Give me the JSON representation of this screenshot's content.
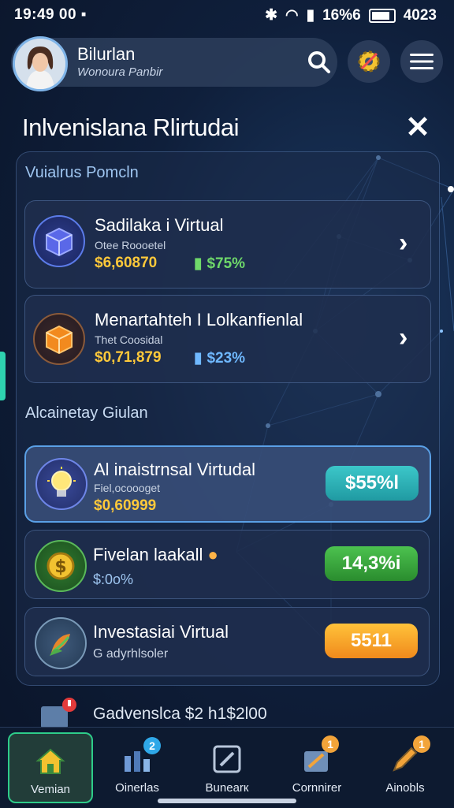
{
  "status_bar": {
    "time": "19:49",
    "left_extra": "00",
    "battery": "16%6",
    "right_text": "4023"
  },
  "header": {
    "user_name": "Bilurlan",
    "user_subtitle": "Wonoura Panbir"
  },
  "page": {
    "title": "Inlvenislana Rlirtudai",
    "close_icon": "✕"
  },
  "section1": {
    "label": "Vuialrus Pomcln",
    "items": [
      {
        "name": "Sadilaka i Virtual",
        "sub": "Otee Roooetel",
        "value": "$6,60870",
        "change": "$75%",
        "icon": "cube-icon"
      },
      {
        "name": "Menartahteh I Lolkanfienlal",
        "sub": "Thet Coosidal",
        "value": "$0,71,879",
        "change": "$23%",
        "icon": "box-icon"
      }
    ]
  },
  "section2": {
    "label": "Alcainetay Giulan",
    "items": [
      {
        "name": "Al inaistrnsal Virtudal",
        "sub": "Fiel,ocoooget",
        "value": "$0,60999",
        "pill": "$55%l",
        "icon": "lightbulb-icon",
        "pill_color": "#2bb3b8"
      },
      {
        "name": "Fivelan laakall",
        "sub": "$:0o%",
        "pill": "14,3%i",
        "icon": "coin-icon",
        "pill_color": "#3aa83e"
      },
      {
        "name": "Investasiai Virtual",
        "sub": "G adyrhlsoler",
        "pill": "5511",
        "icon": "plant-icon",
        "pill_color": "#f0a128"
      }
    ]
  },
  "footer_item": {
    "text": "Gadvenslca $2 h1$2l00"
  },
  "nav": {
    "items": [
      {
        "label": "Vemian",
        "icon": "home-icon"
      },
      {
        "label": "Oinerlas",
        "icon": "chart-icon",
        "badge": "2"
      },
      {
        "label": "Bunearк",
        "icon": "edit-icon"
      },
      {
        "label": "Cornnirer",
        "icon": "community-icon",
        "badge": "1"
      },
      {
        "label": "Ainobls",
        "icon": "pencil-icon",
        "badge": "1"
      }
    ]
  }
}
